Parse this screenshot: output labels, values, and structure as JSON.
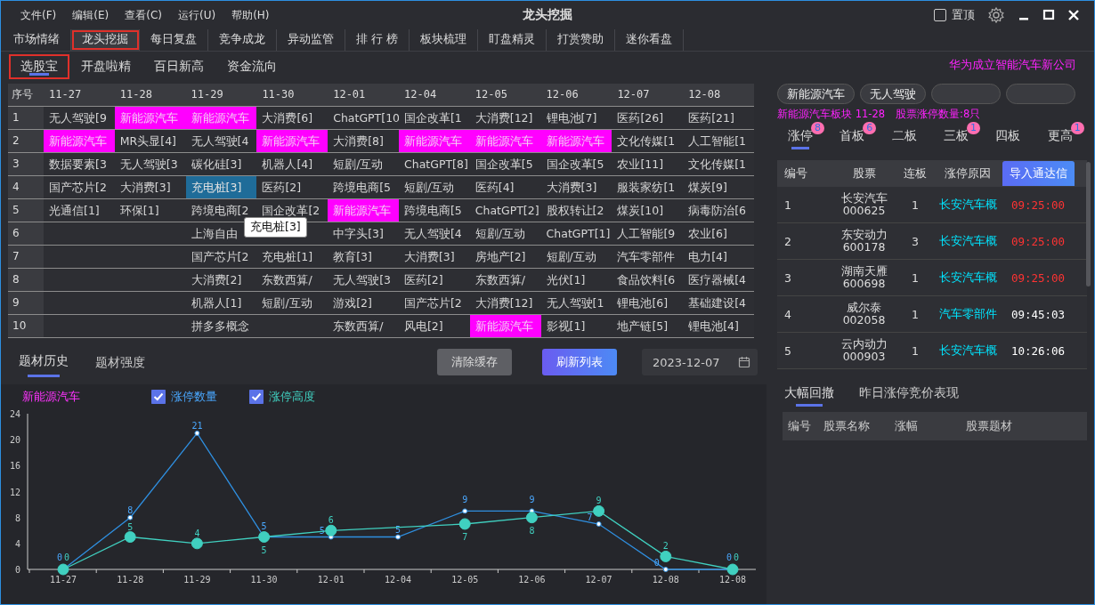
{
  "window": {
    "title": "龙头挖掘",
    "menu": [
      "文件(F)",
      "编辑(E)",
      "查看(C)",
      "运行(U)",
      "帮助(H)"
    ],
    "pin": {
      "label": "置顶",
      "checked": false
    }
  },
  "tabs": [
    {
      "label": "市场情绪",
      "selected": false
    },
    {
      "label": "龙头挖掘",
      "selected": true
    },
    {
      "label": "每日复盘",
      "selected": false
    },
    {
      "label": "竞争成龙",
      "selected": false
    },
    {
      "label": "异动监管",
      "selected": false
    },
    {
      "label": "排 行 榜",
      "selected": false
    },
    {
      "label": "板块梳理",
      "selected": false
    },
    {
      "label": "盯盘精灵",
      "selected": false
    },
    {
      "label": "打赏赞助",
      "selected": false
    },
    {
      "label": "迷你看盘",
      "selected": false
    }
  ],
  "subtabs": [
    {
      "label": "选股宝",
      "selected": true
    },
    {
      "label": "开盘啦精",
      "selected": false
    },
    {
      "label": "百日新高",
      "selected": false
    },
    {
      "label": "资金流向",
      "selected": false
    }
  ],
  "headline": "华为成立智能汽车新公司",
  "grid": {
    "index_header": "序号",
    "columns": [
      "11-27",
      "11-28",
      "11-29",
      "11-30",
      "12-01",
      "12-04",
      "12-05",
      "12-06",
      "12-07",
      "12-08"
    ],
    "tooltip": "充电桩[3]",
    "rows": [
      {
        "no": "1",
        "cells": [
          {
            "text": "无人驾驶[9",
            "highlighted": false,
            "selected": false
          },
          {
            "text": "新能源汽车",
            "highlighted": true,
            "selected": false
          },
          {
            "text": "新能源汽车",
            "highlighted": true,
            "selected": false
          },
          {
            "text": "大消费[6]",
            "highlighted": false,
            "selected": false
          },
          {
            "text": "ChatGPT[10",
            "highlighted": false,
            "selected": false
          },
          {
            "text": "国企改革[1",
            "highlighted": false,
            "selected": false
          },
          {
            "text": "大消费[12]",
            "highlighted": false,
            "selected": false
          },
          {
            "text": "锂电池[7]",
            "highlighted": false,
            "selected": false
          },
          {
            "text": "医药[26]",
            "highlighted": false,
            "selected": false
          },
          {
            "text": "医药[21]",
            "highlighted": false,
            "selected": false
          }
        ]
      },
      {
        "no": "2",
        "cells": [
          {
            "text": "新能源汽车",
            "highlighted": true,
            "selected": false
          },
          {
            "text": "MR头显[4]",
            "highlighted": false,
            "selected": false
          },
          {
            "text": "无人驾驶[4",
            "highlighted": false,
            "selected": false
          },
          {
            "text": "新能源汽车",
            "highlighted": true,
            "selected": false
          },
          {
            "text": "大消费[8]",
            "highlighted": false,
            "selected": false
          },
          {
            "text": "新能源汽车",
            "highlighted": true,
            "selected": false
          },
          {
            "text": "新能源汽车",
            "highlighted": true,
            "selected": false
          },
          {
            "text": "新能源汽车",
            "highlighted": true,
            "selected": false
          },
          {
            "text": "文化传媒[1",
            "highlighted": false,
            "selected": false
          },
          {
            "text": "人工智能[1",
            "highlighted": false,
            "selected": false
          }
        ]
      },
      {
        "no": "3",
        "cells": [
          {
            "text": "数据要素[3",
            "highlighted": false,
            "selected": false
          },
          {
            "text": "无人驾驶[3",
            "highlighted": false,
            "selected": false
          },
          {
            "text": "碳化硅[3]",
            "highlighted": false,
            "selected": false
          },
          {
            "text": "机器人[4]",
            "highlighted": false,
            "selected": false
          },
          {
            "text": "短剧/互动",
            "highlighted": false,
            "selected": false
          },
          {
            "text": "ChatGPT[8]",
            "highlighted": false,
            "selected": false
          },
          {
            "text": "国企改革[5",
            "highlighted": false,
            "selected": false
          },
          {
            "text": "国企改革[5",
            "highlighted": false,
            "selected": false
          },
          {
            "text": "农业[11]",
            "highlighted": false,
            "selected": false
          },
          {
            "text": "文化传媒[1",
            "highlighted": false,
            "selected": false
          }
        ]
      },
      {
        "no": "4",
        "cells": [
          {
            "text": "国产芯片[2",
            "highlighted": false,
            "selected": false
          },
          {
            "text": "大消费[3]",
            "highlighted": false,
            "selected": false
          },
          {
            "text": "充电桩[3]",
            "highlighted": false,
            "selected": true
          },
          {
            "text": "医药[2]",
            "highlighted": false,
            "selected": false
          },
          {
            "text": "跨境电商[5",
            "highlighted": false,
            "selected": false
          },
          {
            "text": "短剧/互动",
            "highlighted": false,
            "selected": false
          },
          {
            "text": "医药[4]",
            "highlighted": false,
            "selected": false
          },
          {
            "text": "大消费[3]",
            "highlighted": false,
            "selected": false
          },
          {
            "text": "服装家纺[1",
            "highlighted": false,
            "selected": false
          },
          {
            "text": "煤炭[9]",
            "highlighted": false,
            "selected": false
          }
        ]
      },
      {
        "no": "5",
        "cells": [
          {
            "text": "光通信[1]",
            "highlighted": false,
            "selected": false
          },
          {
            "text": "环保[1]",
            "highlighted": false,
            "selected": false
          },
          {
            "text": "跨境电商[2",
            "highlighted": false,
            "selected": false
          },
          {
            "text": "国企改革[2",
            "highlighted": false,
            "selected": false
          },
          {
            "text": "新能源汽车",
            "highlighted": true,
            "selected": false
          },
          {
            "text": "跨境电商[5",
            "highlighted": false,
            "selected": false
          },
          {
            "text": "ChatGPT[2]",
            "highlighted": false,
            "selected": false
          },
          {
            "text": "股权转让[2",
            "highlighted": false,
            "selected": false
          },
          {
            "text": "煤炭[10]",
            "highlighted": false,
            "selected": false
          },
          {
            "text": "病毒防治[6",
            "highlighted": false,
            "selected": false
          }
        ]
      },
      {
        "no": "6",
        "cells": [
          {
            "highlighted": false,
            "selected": false
          },
          {
            "highlighted": false,
            "selected": false
          },
          {
            "text": "上海自由",
            "highlighted": false,
            "selected": false
          },
          {
            "highlighted": false,
            "selected": false
          },
          {
            "text": "中字头[3]",
            "highlighted": false,
            "selected": false
          },
          {
            "text": "无人驾驶[4",
            "highlighted": false,
            "selected": false
          },
          {
            "text": "短剧/互动",
            "highlighted": false,
            "selected": false
          },
          {
            "text": "ChatGPT[1]",
            "highlighted": false,
            "selected": false
          },
          {
            "text": "人工智能[9",
            "highlighted": false,
            "selected": false
          },
          {
            "text": "农业[6]",
            "highlighted": false,
            "selected": false
          }
        ]
      },
      {
        "no": "7",
        "cells": [
          {
            "highlighted": false,
            "selected": false
          },
          {
            "highlighted": false,
            "selected": false
          },
          {
            "text": "国产芯片[2",
            "highlighted": false,
            "selected": false
          },
          {
            "text": "充电桩[1]",
            "highlighted": false,
            "selected": false
          },
          {
            "text": "教育[3]",
            "highlighted": false,
            "selected": false
          },
          {
            "text": "大消费[3]",
            "highlighted": false,
            "selected": false
          },
          {
            "text": "房地产[2]",
            "highlighted": false,
            "selected": false
          },
          {
            "text": "短剧/互动",
            "highlighted": false,
            "selected": false
          },
          {
            "text": "汽车零部件",
            "highlighted": false,
            "selected": false
          },
          {
            "text": "电力[4]",
            "highlighted": false,
            "selected": false
          }
        ]
      },
      {
        "no": "8",
        "cells": [
          {
            "highlighted": false,
            "selected": false
          },
          {
            "highlighted": false,
            "selected": false
          },
          {
            "text": "大消费[2]",
            "highlighted": false,
            "selected": false
          },
          {
            "text": "东数西算/",
            "highlighted": false,
            "selected": false
          },
          {
            "text": "无人驾驶[3",
            "highlighted": false,
            "selected": false
          },
          {
            "text": "医药[2]",
            "highlighted": false,
            "selected": false
          },
          {
            "text": "东数西算/",
            "highlighted": false,
            "selected": false
          },
          {
            "text": "光伏[1]",
            "highlighted": false,
            "selected": false
          },
          {
            "text": "食品饮料[6",
            "highlighted": false,
            "selected": false
          },
          {
            "text": "医疗器械[4",
            "highlighted": false,
            "selected": false
          }
        ]
      },
      {
        "no": "9",
        "cells": [
          {
            "highlighted": false,
            "selected": false
          },
          {
            "highlighted": false,
            "selected": false
          },
          {
            "text": "机器人[1]",
            "highlighted": false,
            "selected": false
          },
          {
            "text": "短剧/互动",
            "highlighted": false,
            "selected": false
          },
          {
            "text": "游戏[2]",
            "highlighted": false,
            "selected": false
          },
          {
            "text": "国产芯片[2",
            "highlighted": false,
            "selected": false
          },
          {
            "text": "大消费[12]",
            "highlighted": false,
            "selected": false
          },
          {
            "text": "无人驾驶[1",
            "highlighted": false,
            "selected": false
          },
          {
            "text": "锂电池[6]",
            "highlighted": false,
            "selected": false
          },
          {
            "text": "基础建设[4",
            "highlighted": false,
            "selected": false
          }
        ]
      },
      {
        "no": "10",
        "cells": [
          {
            "highlighted": false,
            "selected": false
          },
          {
            "highlighted": false,
            "selected": false
          },
          {
            "text": "拼多多概念",
            "highlighted": false,
            "selected": false
          },
          {
            "highlighted": false,
            "selected": false
          },
          {
            "text": "东数西算/",
            "highlighted": false,
            "selected": false
          },
          {
            "text": "风电[2]",
            "highlighted": false,
            "selected": false
          },
          {
            "text": "新能源汽车",
            "highlighted": true,
            "selected": false
          },
          {
            "text": "影视[1]",
            "highlighted": false,
            "selected": false
          },
          {
            "text": "地产链[5]",
            "highlighted": false,
            "selected": false
          },
          {
            "text": "锂电池[4]",
            "highlighted": false,
            "selected": false
          }
        ]
      }
    ]
  },
  "history": {
    "tabs": [
      {
        "label": "题材历史",
        "selected": true
      },
      {
        "label": "题材强度",
        "selected": false
      }
    ],
    "buttons": [
      {
        "label": "清除缓存",
        "kind": "secondary"
      },
      {
        "label": "刷新列表",
        "kind": "primary"
      }
    ],
    "date": "2023-12-07",
    "legend": [
      {
        "checked": true
      },
      {
        "checked": true
      }
    ],
    "chart_data": {
      "type": "line",
      "title": "新能源汽车",
      "categories": [
        "11-27",
        "11-28",
        "11-29",
        "11-30",
        "12-01",
        "12-04",
        "12-05",
        "12-06",
        "12-07",
        "12-08",
        "12-08"
      ],
      "ylim": [
        0,
        24
      ],
      "yticks": [
        0,
        4,
        8,
        12,
        16,
        20,
        24
      ],
      "data_labels": true,
      "series": [
        {
          "name": "涨停数量",
          "color": "#2f8fe0",
          "marker": "circle",
          "values": [
            0,
            8,
            21,
            5,
            5,
            5,
            9,
            9,
            7,
            0,
            0
          ]
        },
        {
          "name": "涨停高度",
          "color": "#40d0c0",
          "marker": "circle",
          "values": [
            0,
            5,
            4,
            5,
            6,
            null,
            7,
            8,
            9,
            2,
            0
          ]
        }
      ]
    }
  },
  "side": {
    "chips": [
      {
        "kind": "label",
        "label": "新能源汽车"
      },
      {
        "kind": "label",
        "label": "无人驾驶"
      },
      {
        "kind": "empty"
      },
      {
        "kind": "empty"
      }
    ],
    "info": [
      "新能源汽车板块 11-28",
      "股票涨停数量:8只"
    ],
    "tabs": [
      {
        "label": "涨停",
        "badge": "8",
        "selected": true
      },
      {
        "label": "首板",
        "badge": "6",
        "selected": false
      },
      {
        "label": "二板",
        "selected": false
      },
      {
        "label": "三板",
        "badge": "1",
        "selected": false
      },
      {
        "label": "四板",
        "selected": false
      },
      {
        "label": "更高",
        "badge": "1",
        "selected": false
      }
    ],
    "columns": [
      "编号",
      "股票",
      "连板",
      "涨停原因"
    ],
    "export_button": "导入通达信",
    "rows": [
      {
        "no": "1",
        "name": "长安汽车",
        "code": "000625",
        "boards": "1",
        "reason": "长安汽车概",
        "time": "09:25:00",
        "color": "#ff3333"
      },
      {
        "no": "2",
        "name": "东安动力",
        "code": "600178",
        "boards": "3",
        "reason": "长安汽车概",
        "time": "09:25:00",
        "color": "#ff3333"
      },
      {
        "no": "3",
        "name": "湖南天雁",
        "code": "600698",
        "boards": "1",
        "reason": "长安汽车概",
        "time": "09:25:00",
        "color": "#ff3333"
      },
      {
        "no": "4",
        "name": "威尔泰",
        "code": "002058",
        "boards": "1",
        "reason": "汽车零部件",
        "time": "09:45:03",
        "color": "#ffffff"
      },
      {
        "no": "5",
        "name": "云内动力",
        "code": "000903",
        "boards": "1",
        "reason": "长安汽车概",
        "time": "10:26:06",
        "color": "#ffffff"
      }
    ],
    "bottom_tabs": [
      {
        "label": "大幅回撤",
        "selected": true
      },
      {
        "label": "昨日涨停竞价表现",
        "selected": false
      }
    ],
    "bottom_columns": [
      "编号",
      "股票名称",
      "涨幅",
      "股票题材"
    ]
  }
}
